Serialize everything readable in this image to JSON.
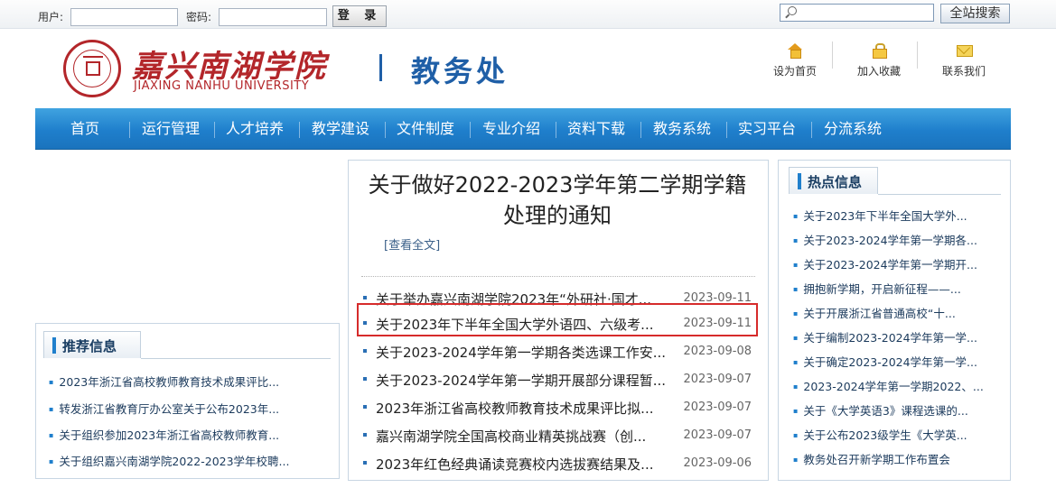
{
  "topbar": {
    "user_label": "用户:",
    "password_label": "密码:",
    "user_value": "",
    "password_value": "",
    "login_label": "登 录",
    "search_value": "",
    "search_button": "全站搜索"
  },
  "header": {
    "school_cn": "嘉兴南湖学院",
    "school_en": "JIAXING NANHU UNIVERSITY",
    "dept_title": "教务处",
    "quick_links": [
      {
        "label": "设为首页",
        "icon": "home-icon"
      },
      {
        "label": "加入收藏",
        "icon": "lock-icon"
      },
      {
        "label": "联系我们",
        "icon": "mail-icon"
      }
    ]
  },
  "nav": {
    "items": [
      "首页",
      "运行管理",
      "人才培养",
      "教学建设",
      "文件制度",
      "专业介绍",
      "资料下载",
      "教务系统",
      "实习平台",
      "分流系统"
    ]
  },
  "news": {
    "headline": "关于做好2022-2023学年第二学期学籍处理的通知",
    "read_more": "[查看全文]",
    "items": [
      {
        "title": "关于举办嘉兴南湖学院2023年“外研社·国才...",
        "date": "2023-09-11"
      },
      {
        "title": "关于2023年下半年全国大学外语四、六级考...",
        "date": "2023-09-11"
      },
      {
        "title": "关于2023-2024学年第一学期各类选课工作安...",
        "date": "2023-09-08"
      },
      {
        "title": "关于2023-2024学年第一学期开展部分课程暂...",
        "date": "2023-09-07"
      },
      {
        "title": "2023年浙江省高校教师教育技术成果评比拟...",
        "date": "2023-09-07"
      },
      {
        "title": "嘉兴南湖学院全国高校商业精英挑战赛（创...",
        "date": "2023-09-07"
      },
      {
        "title": "2023年红色经典诵读竞赛校内选拔赛结果及...",
        "date": "2023-09-06"
      }
    ]
  },
  "recommend": {
    "title": "推荐信息",
    "items": [
      "2023年浙江省高校教师教育技术成果评比...",
      "转发浙江省教育厅办公室关于公布2023年...",
      "关于组织参加2023年浙江省高校教师教育...",
      "关于组织嘉兴南湖学院2022-2023学年校聘..."
    ]
  },
  "hot": {
    "title": "热点信息",
    "items": [
      "关于2023年下半年全国大学外...",
      "关于2023-2024学年第一学期各...",
      "关于2023-2024学年第一学期开...",
      "拥抱新学期，开启新征程——...",
      "关于开展浙江省普通高校“十...",
      "关于编制2023-2024学年第一学...",
      "关于确定2023-2024学年第一学...",
      "2023-2024学年第一学期2022、...",
      "关于《大学英语3》课程选课的...",
      "关于公布2023级学生《大学英...",
      "教务处召开新学期工作布置会"
    ]
  },
  "colors": {
    "brand_red": "#b3262a",
    "brand_blue": "#1f5fa7",
    "nav_blue": "#1f7fcc",
    "highlight_red": "#d62b2b"
  }
}
